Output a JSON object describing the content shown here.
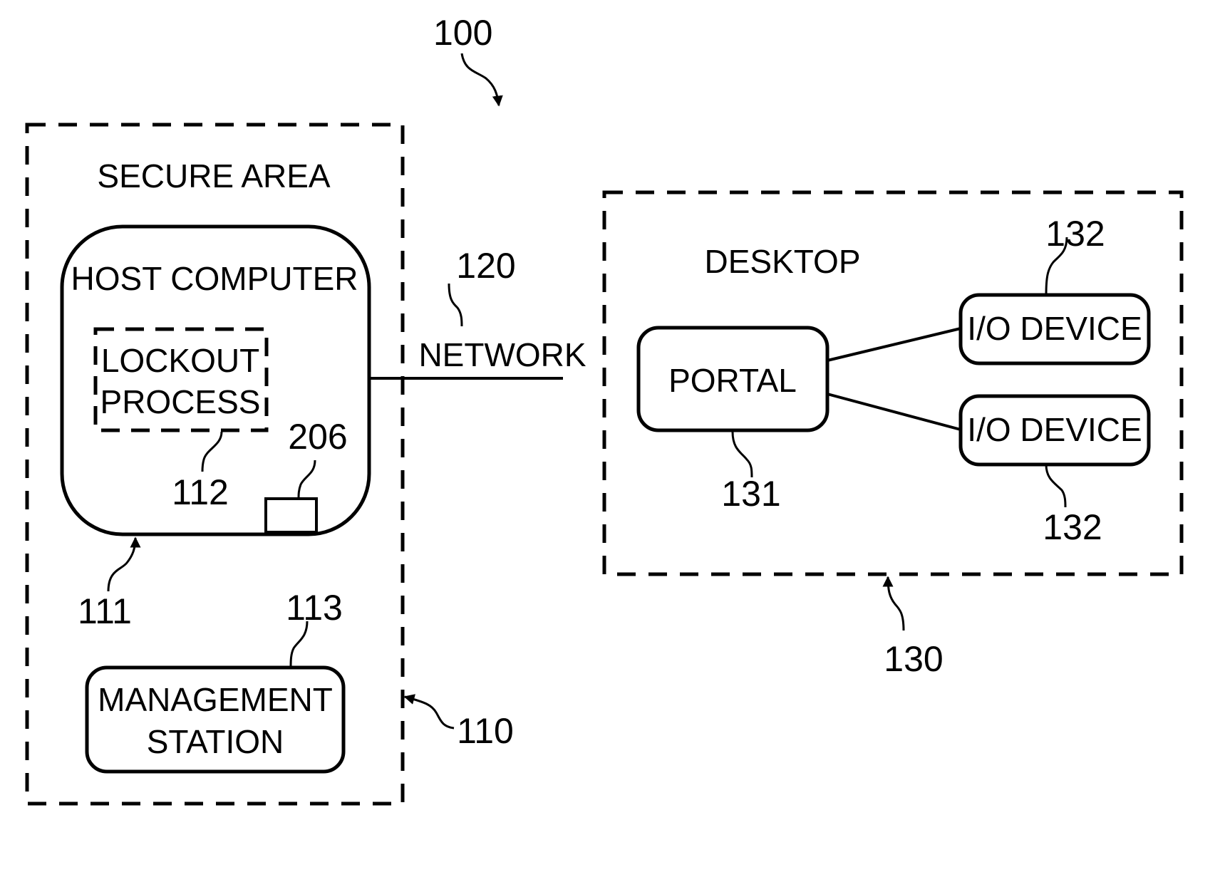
{
  "figure": {
    "ref": "100",
    "secure_area": {
      "title": "SECURE AREA",
      "ref": "110",
      "host_computer": {
        "title": "HOST COMPUTER",
        "ref": "111",
        "lockout_process": {
          "line1": "LOCKOUT",
          "line2": "PROCESS",
          "ref": "112"
        },
        "component_ref": "206"
      },
      "management_station": {
        "line1": "MANAGEMENT",
        "line2": "STATION",
        "ref": "113"
      }
    },
    "network": {
      "label": "NETWORK",
      "ref": "120"
    },
    "desktop": {
      "title": "DESKTOP",
      "ref": "130",
      "portal": {
        "label": "PORTAL",
        "ref": "131"
      },
      "io_devices": [
        {
          "label": "I/O DEVICE",
          "ref": "132"
        },
        {
          "label": "I/O DEVICE",
          "ref": "132"
        }
      ]
    }
  }
}
